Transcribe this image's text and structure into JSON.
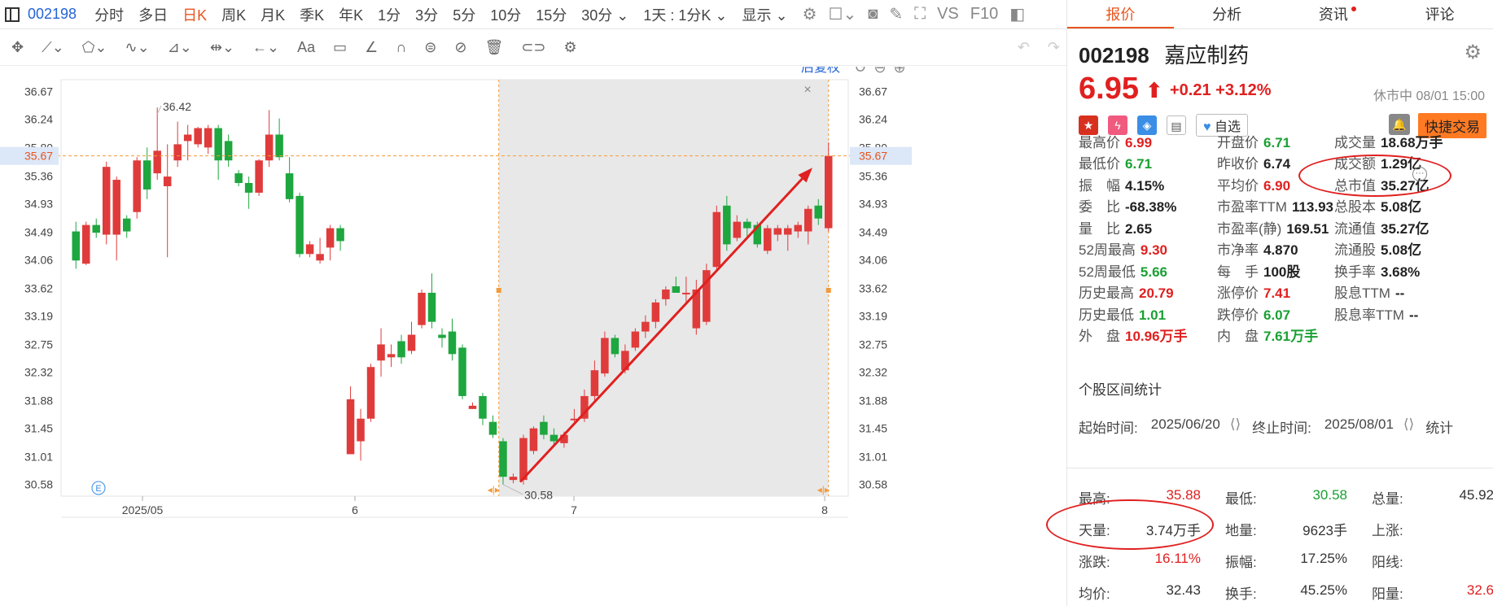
{
  "toolbar": {
    "code": "002198",
    "timeframes": [
      "分时",
      "多日",
      "日K",
      "周K",
      "月K",
      "季K",
      "年K",
      "1分",
      "3分",
      "5分",
      "10分",
      "15分",
      "30分 ⌄",
      "1天 : 1分K ⌄",
      "显示 ⌄"
    ],
    "active_timeframe": "日K",
    "vs_label": "VS",
    "f10_label": "F10"
  },
  "drawing_tools": [
    "move-tool",
    "line-tool",
    "shape-tool",
    "wave-tool",
    "measure-tool",
    "range-tool",
    "arrow-tool",
    "text-tool",
    "comment-tool",
    "pen-tool",
    "magnet-tool",
    "lock-tool",
    "hide-tool",
    "delete-tool",
    "link-tool",
    "settings-tool"
  ],
  "chart_controls": {
    "adjust_label": "后复权"
  },
  "chart_data": {
    "type": "candlestick",
    "y_ticks": [
      "36.67",
      "36.24",
      "35.80",
      "35.36",
      "34.93",
      "34.49",
      "34.06",
      "33.62",
      "33.19",
      "32.75",
      "32.32",
      "31.88",
      "31.45",
      "31.01",
      "30.58"
    ],
    "ylim": [
      30.4,
      36.85
    ],
    "x_ticks": [
      "2025/05",
      "6",
      "7",
      "8"
    ],
    "crosshair_price": "35.67",
    "high_annotation": "36.42",
    "low_annotation": "30.58",
    "candles": [
      [
        34.5,
        34.05,
        34.65,
        33.92
      ],
      [
        34.0,
        34.6,
        34.65,
        33.98
      ],
      [
        34.6,
        34.48,
        34.7,
        34.4
      ],
      [
        34.45,
        35.5,
        35.58,
        34.3
      ],
      [
        34.45,
        35.3,
        35.35,
        34.05
      ],
      [
        34.7,
        34.5,
        34.75,
        34.4
      ],
      [
        34.8,
        35.6,
        35.65,
        34.7
      ],
      [
        35.6,
        35.15,
        35.8,
        35.0
      ],
      [
        35.4,
        35.75,
        36.42,
        35.3
      ],
      [
        35.2,
        35.35,
        35.85,
        34.1
      ],
      [
        35.6,
        35.85,
        36.2,
        35.5
      ],
      [
        35.9,
        36.0,
        36.15,
        35.6
      ],
      [
        35.85,
        36.1,
        36.12,
        35.8
      ],
      [
        35.8,
        36.1,
        36.15,
        35.7
      ],
      [
        36.1,
        35.6,
        36.15,
        35.3
      ],
      [
        35.9,
        35.6,
        36.0,
        35.5
      ],
      [
        35.4,
        35.25,
        35.45,
        35.2
      ],
      [
        35.25,
        35.1,
        35.35,
        34.85
      ],
      [
        35.1,
        35.6,
        35.62,
        35.05
      ],
      [
        35.6,
        36.0,
        36.38,
        35.5
      ],
      [
        36.0,
        35.65,
        36.25,
        35.6
      ],
      [
        35.4,
        35.0,
        35.65,
        34.95
      ],
      [
        35.05,
        34.15,
        35.1,
        34.1
      ],
      [
        34.15,
        34.3,
        34.35,
        34.1
      ],
      [
        34.05,
        34.15,
        34.4,
        34.0
      ],
      [
        34.25,
        34.55,
        34.6,
        34.05
      ],
      [
        34.55,
        34.35,
        34.6,
        34.2
      ],
      [
        31.05,
        31.9,
        32.1,
        31.05
      ],
      [
        31.25,
        31.6,
        31.75,
        30.95
      ],
      [
        31.6,
        32.4,
        32.45,
        31.55
      ],
      [
        32.5,
        32.75,
        33.0,
        32.25
      ],
      [
        32.55,
        32.6,
        32.75,
        32.4
      ],
      [
        32.8,
        32.55,
        32.9,
        32.45
      ],
      [
        32.65,
        32.9,
        33.1,
        32.6
      ],
      [
        33.05,
        33.55,
        33.6,
        33.0
      ],
      [
        33.55,
        33.1,
        33.85,
        33.0
      ],
      [
        32.9,
        32.85,
        33.0,
        32.7
      ],
      [
        32.95,
        32.6,
        33.15,
        32.5
      ],
      [
        32.7,
        31.95,
        32.75,
        31.9
      ],
      [
        31.75,
        31.8,
        31.85,
        31.75
      ],
      [
        31.95,
        31.6,
        32.0,
        31.5
      ],
      [
        31.55,
        31.35,
        31.65,
        31.3
      ],
      [
        31.25,
        30.7,
        31.3,
        30.58
      ],
      [
        30.65,
        30.7,
        30.75,
        30.6
      ],
      [
        30.65,
        31.3,
        31.35,
        30.58
      ],
      [
        31.1,
        31.45,
        31.48,
        31.05
      ],
      [
        31.55,
        31.35,
        31.65,
        31.28
      ],
      [
        31.35,
        31.25,
        31.45,
        31.18
      ],
      [
        31.22,
        31.35,
        31.4,
        31.15
      ],
      [
        31.58,
        31.6,
        31.75,
        31.55
      ],
      [
        31.6,
        31.95,
        32.05,
        31.55
      ],
      [
        31.95,
        32.35,
        32.5,
        31.85
      ],
      [
        32.3,
        32.85,
        32.95,
        32.25
      ],
      [
        32.85,
        32.6,
        32.9,
        32.55
      ],
      [
        32.35,
        32.65,
        32.75,
        32.3
      ],
      [
        32.7,
        32.95,
        33.0,
        32.65
      ],
      [
        32.95,
        33.1,
        33.2,
        32.85
      ],
      [
        33.1,
        33.4,
        33.45,
        33.0
      ],
      [
        33.45,
        33.6,
        33.65,
        33.35
      ],
      [
        33.65,
        33.55,
        33.8,
        33.55
      ],
      [
        33.55,
        33.55,
        33.8,
        33.4
      ],
      [
        33.0,
        33.6,
        33.75,
        32.9
      ],
      [
        33.1,
        33.9,
        34.0,
        33.05
      ],
      [
        33.95,
        34.8,
        34.9,
        33.9
      ],
      [
        34.9,
        34.3,
        35.05,
        34.2
      ],
      [
        34.4,
        34.65,
        34.75,
        34.35
      ],
      [
        34.65,
        34.55,
        34.7,
        34.4
      ],
      [
        34.6,
        34.3,
        34.65,
        34.25
      ],
      [
        34.2,
        34.55,
        34.6,
        34.15
      ],
      [
        34.45,
        34.55,
        34.6,
        34.35
      ],
      [
        34.45,
        34.55,
        34.6,
        34.2
      ],
      [
        34.5,
        34.6,
        34.65,
        34.4
      ],
      [
        34.5,
        34.85,
        34.9,
        34.3
      ],
      [
        34.9,
        34.7,
        35.0,
        34.6
      ],
      [
        34.55,
        35.67,
        35.88,
        34.5
      ]
    ]
  },
  "quote": {
    "tabs": [
      "报价",
      "分析",
      "资讯",
      "评论"
    ],
    "code": "002198",
    "name": "嘉应制药",
    "price": "6.95",
    "change": "+0.21",
    "change_pct": "+3.12%",
    "status": "休市中 08/01 15:00",
    "zixuan": "自选",
    "trade_button": "快捷交易",
    "stats": [
      [
        {
          "l": "最高价",
          "v": "6.99",
          "c": "red"
        },
        {
          "l": "开盘价",
          "v": "6.71",
          "c": "green"
        },
        {
          "l": "成交量",
          "v": "18.68万手",
          "c": ""
        }
      ],
      [
        {
          "l": "最低价",
          "v": "6.71",
          "c": "green"
        },
        {
          "l": "昨收价",
          "v": "6.74",
          "c": ""
        },
        {
          "l": "成交额",
          "v": "1.29亿",
          "c": ""
        }
      ],
      [
        {
          "l": "振　幅",
          "v": "4.15%",
          "c": ""
        },
        {
          "l": "平均价",
          "v": "6.90",
          "c": "red"
        },
        {
          "l": "总市值",
          "v": "35.27亿",
          "c": ""
        }
      ],
      [
        {
          "l": "委　比",
          "v": "-68.38%",
          "c": ""
        },
        {
          "l": "市盈率TTM",
          "v": "113.93",
          "c": ""
        },
        {
          "l": "总股本",
          "v": "5.08亿",
          "c": ""
        }
      ],
      [
        {
          "l": "量　比",
          "v": "2.65",
          "c": ""
        },
        {
          "l": "市盈率(静)",
          "v": "169.51",
          "c": ""
        },
        {
          "l": "流通值",
          "v": "35.27亿",
          "c": ""
        }
      ],
      [
        {
          "l": "52周最高",
          "v": "9.30",
          "c": "red"
        },
        {
          "l": "市净率",
          "v": "4.870",
          "c": ""
        },
        {
          "l": "流通股",
          "v": "5.08亿",
          "c": ""
        }
      ],
      [
        {
          "l": "52周最低",
          "v": "5.66",
          "c": "green"
        },
        {
          "l": "每　手",
          "v": "100股",
          "c": ""
        },
        {
          "l": "换手率",
          "v": "3.68%",
          "c": ""
        }
      ],
      [
        {
          "l": "历史最高",
          "v": "20.79",
          "c": "red"
        },
        {
          "l": "涨停价",
          "v": "7.41",
          "c": "red"
        },
        {
          "l": "股息TTM",
          "v": "--",
          "c": ""
        }
      ],
      [
        {
          "l": "历史最低",
          "v": "1.01",
          "c": "green"
        },
        {
          "l": "跌停价",
          "v": "6.07",
          "c": "green"
        },
        {
          "l": "股息率TTM",
          "v": "--",
          "c": ""
        }
      ],
      [
        {
          "l": "外　盘",
          "v": "10.96万手",
          "c": "red"
        },
        {
          "l": "内　盘",
          "v": "7.61万手",
          "c": "green"
        },
        {
          "l": "",
          "v": "",
          "c": ""
        }
      ]
    ]
  },
  "interval": {
    "title": "个股区间统计",
    "start_label": "起始时间:",
    "start": "2025/06/20",
    "end_label": "终止时间:",
    "end": "2025/08/01",
    "stats_link": "统计",
    "rows": [
      [
        {
          "l": "最高:",
          "v": "35.88",
          "c": "red"
        },
        {
          "l": "最低:",
          "v": "30.58",
          "c": "green"
        },
        {
          "l": "总量:",
          "v": "45.92",
          "c": ""
        }
      ],
      [
        {
          "l": "天量:",
          "v": "3.74万手",
          "c": ""
        },
        {
          "l": "地量:",
          "v": "9623手",
          "c": ""
        },
        {
          "l": "上涨:",
          "v": "",
          "c": ""
        }
      ],
      [
        {
          "l": "涨跌:",
          "v": "16.11%",
          "c": "red"
        },
        {
          "l": "振幅:",
          "v": "17.25%",
          "c": ""
        },
        {
          "l": "阳线:",
          "v": "",
          "c": ""
        }
      ],
      [
        {
          "l": "均价:",
          "v": "32.43",
          "c": ""
        },
        {
          "l": "换手:",
          "v": "45.25%",
          "c": ""
        },
        {
          "l": "阳量:",
          "v": "32.6",
          "c": "red"
        }
      ]
    ]
  },
  "colors": {
    "up": "#e03b3b",
    "down": "#1ea63f",
    "accent": "#e8541e",
    "annotation": "#e02020"
  }
}
